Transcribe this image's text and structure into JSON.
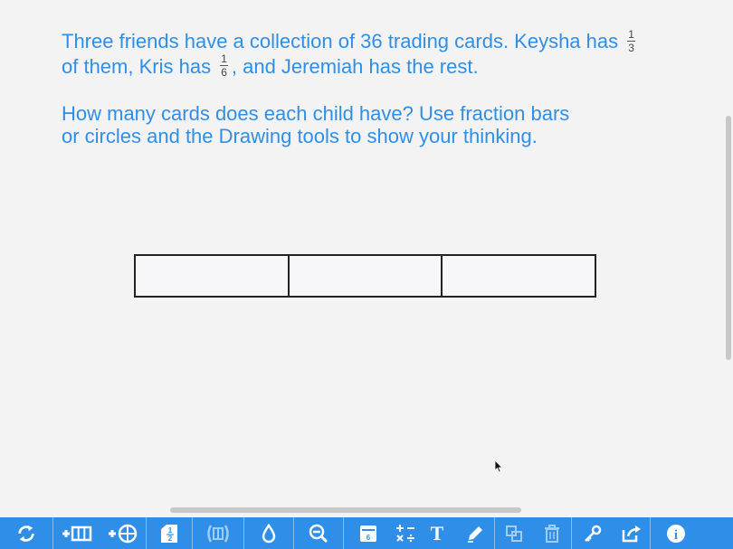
{
  "prompt": {
    "line1_a": "Three friends have a collection of 36 trading cards. Keysha has",
    "line1_frac": {
      "num": "1",
      "den": "3"
    },
    "line2_a": "of them, Kris has",
    "line2_frac": {
      "num": "1",
      "den": "6"
    },
    "line2_b": ", and Jeremiah has the rest.",
    "question_line1": "How many cards does each child have? Use fraction bars",
    "question_line2": "or circles and the Drawing tools to show your thinking."
  },
  "fraction_bar": {
    "segments": 3
  },
  "colors": {
    "accent": "#2f8fe8",
    "background": "#f3f3f4",
    "toolbar": "#2f8fe8"
  },
  "toolbar": {
    "buttons": [
      {
        "icon": "refresh-icon",
        "enabled": true
      },
      {
        "icon": "add-bar-icon",
        "enabled": true
      },
      {
        "icon": "add-circle-icon",
        "enabled": true
      },
      {
        "icon": "fraction-label-icon",
        "label": "½",
        "enabled": true
      },
      {
        "icon": "split-icon",
        "enabled": false
      },
      {
        "icon": "fill-color-icon",
        "enabled": true
      },
      {
        "icon": "zoom-out-icon",
        "enabled": true
      },
      {
        "icon": "calculator-display-icon",
        "enabled": true
      },
      {
        "icon": "operations-icon",
        "enabled": true
      },
      {
        "icon": "text-tool-icon",
        "label": "T",
        "enabled": true
      },
      {
        "icon": "pencil-icon",
        "enabled": true
      },
      {
        "icon": "duplicate-icon",
        "enabled": false
      },
      {
        "icon": "trash-icon",
        "enabled": false
      },
      {
        "icon": "key-icon",
        "enabled": true
      },
      {
        "icon": "share-icon",
        "enabled": true
      },
      {
        "icon": "info-icon",
        "label": "i",
        "enabled": true
      }
    ]
  }
}
